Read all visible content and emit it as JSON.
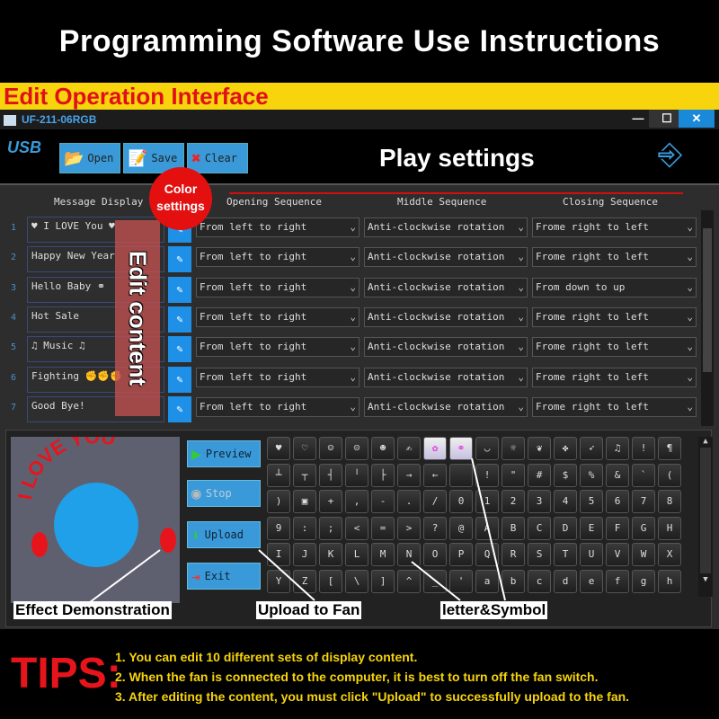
{
  "banner": {
    "title": "Programming Software Use Instructions",
    "section": "Edit Operation Interface"
  },
  "window": {
    "title": "UF-211-06RGB",
    "controls": [
      "—",
      "☐",
      "✕"
    ]
  },
  "toolbar": {
    "usb_logo": "USB",
    "open": "Open",
    "save": "Save",
    "clear": "Clear"
  },
  "annotations": {
    "play_settings": "Play settings",
    "color_settings_1": "Color",
    "color_settings_2": "settings",
    "edit_content": "Edit content",
    "effect": "Effect Demonstration",
    "upload": "Upload to Fan",
    "letters": "letter&Symbol"
  },
  "headers": {
    "message": "Message Display",
    "opening": "Opening Sequence",
    "middle": "Middle Sequence",
    "closing": "Closing Sequence"
  },
  "rows": [
    {
      "n": "1",
      "msg": "♥ I LOVE You ♥",
      "open": "From left to right",
      "mid": "Anti-clockwise rotation",
      "close": "Frome right to left"
    },
    {
      "n": "2",
      "msg": "Happy New Year",
      "open": "From left to right",
      "mid": "Anti-clockwise rotation",
      "close": "Frome right to left"
    },
    {
      "n": "3",
      "msg": "Hello Baby ⚭",
      "open": "From left to right",
      "mid": "Anti-clockwise rotation",
      "close": "From down to up"
    },
    {
      "n": "4",
      "msg": "Hot Sale",
      "open": "From left to right",
      "mid": "Anti-clockwise rotation",
      "close": "Frome right to left"
    },
    {
      "n": "5",
      "msg": "♫ Music ♫",
      "open": "From left to right",
      "mid": "Anti-clockwise rotation",
      "close": "Frome right to left"
    },
    {
      "n": "6",
      "msg": "Fighting ✊✊✊",
      "open": "From left to right",
      "mid": "Anti-clockwise rotation",
      "close": "Frome right to left"
    },
    {
      "n": "7",
      "msg": "Good Bye!",
      "open": "From left to right",
      "mid": "Anti-clockwise rotation",
      "close": "Frome right to left"
    }
  ],
  "preview": {
    "text": "I LOVE YOU",
    "circle_color": "#1fa0e8",
    "text_color": "#e8141c"
  },
  "side_buttons": {
    "preview": "Preview",
    "stop": "Stop",
    "upload": "Upload",
    "exit": "Exit"
  },
  "keyboard": [
    [
      "♥",
      "♡",
      "☺",
      "☹",
      "☻",
      "✍",
      "✿",
      "⚭",
      "◡",
      "☼",
      "❦",
      "✤",
      "➶",
      "♫",
      "!",
      "¶"
    ],
    [
      "┴",
      "┬",
      "┤",
      "╵",
      "├",
      "→",
      "←",
      " ",
      "!",
      "\"",
      "#",
      "$",
      "%",
      "&",
      "`",
      "("
    ],
    [
      ")",
      "▣",
      "+",
      ",",
      "-",
      ".",
      "/",
      "0",
      "1",
      "2",
      "3",
      "4",
      "5",
      "6",
      "7",
      "8"
    ],
    [
      "9",
      ":",
      ";",
      "<",
      "=",
      ">",
      "?",
      "@",
      "A",
      "B",
      "C",
      "D",
      "E",
      "F",
      "G",
      "H"
    ],
    [
      "I",
      "J",
      "K",
      "L",
      "M",
      "N",
      "O",
      "P",
      "Q",
      "R",
      "S",
      "T",
      "U",
      "V",
      "W",
      "X"
    ],
    [
      "Y",
      "Z",
      "[",
      "\\",
      "]",
      "^",
      "_",
      "'",
      "a",
      "b",
      "c",
      "d",
      "e",
      "f",
      "g",
      "h"
    ]
  ],
  "keyboard_highlighted": [
    6,
    7
  ],
  "tips": {
    "label": "TIPS:",
    "lines": [
      "1. You can edit 10 different sets of display content.",
      "2. When the fan is connected to the computer, it is best to turn off the fan switch.",
      "3. After editing the content, you must click \"Upload\" to successfully upload to the fan."
    ]
  }
}
